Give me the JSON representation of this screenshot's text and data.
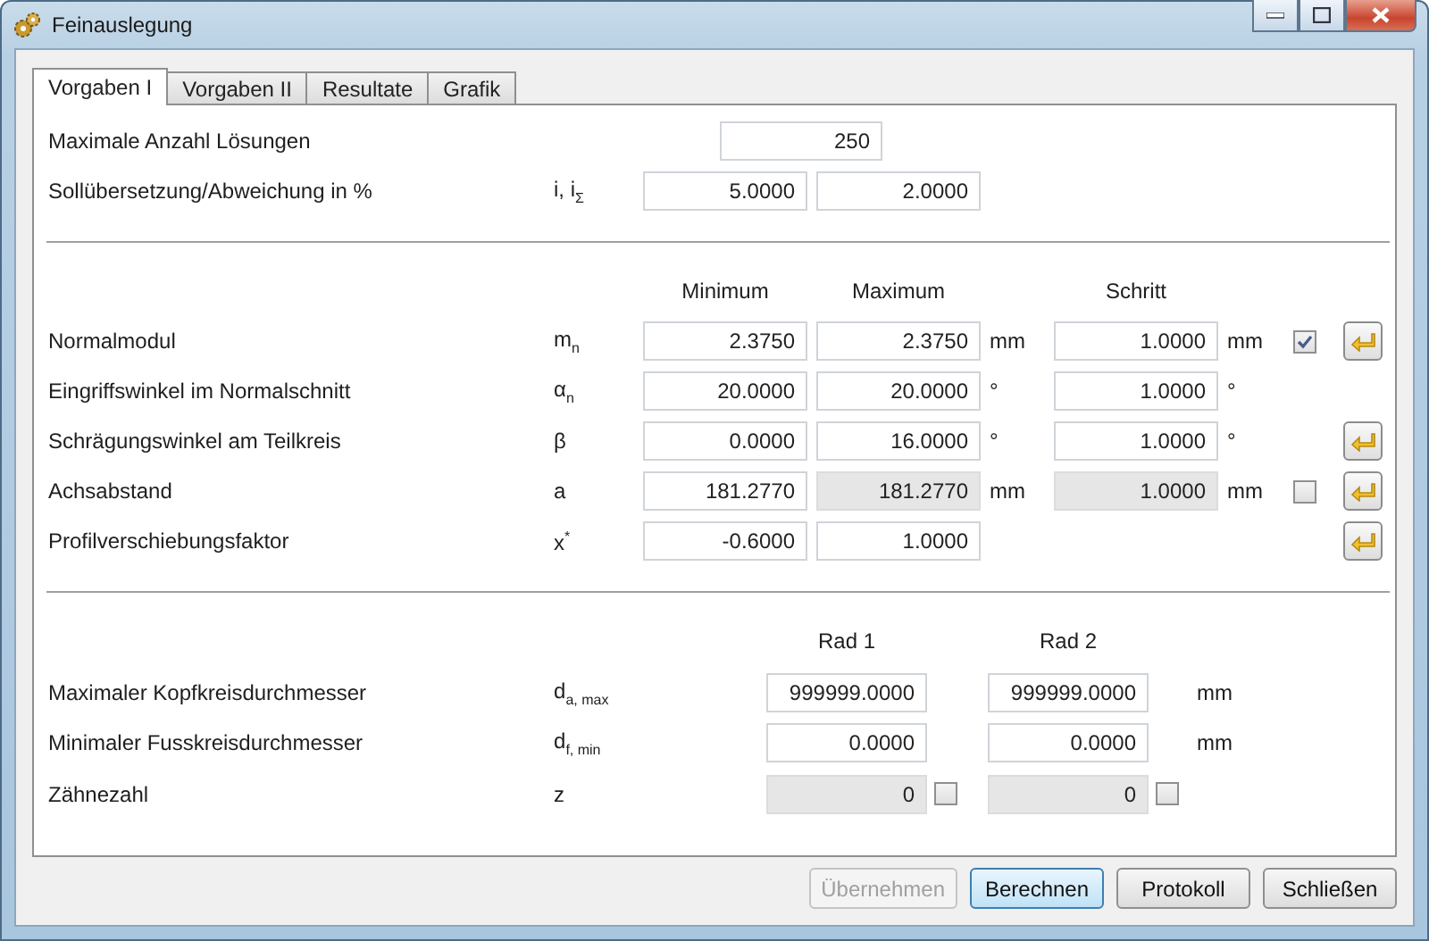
{
  "window": {
    "title": "Feinauslegung"
  },
  "tabs": [
    {
      "label": "Vorgaben I",
      "selected": true
    },
    {
      "label": "Vorgaben II",
      "selected": false
    },
    {
      "label": "Resultate",
      "selected": false
    },
    {
      "label": "Grafik",
      "selected": false
    }
  ],
  "max_solutions": {
    "label": "Maximale Anzahl Lösungen",
    "value": "250"
  },
  "target_ratio": {
    "label": "Sollübersetzung/Abweichung in %",
    "symbol": "i, i$_{Σ}$",
    "fields": [
      {
        "value": "5.0000",
        "disabled": false
      },
      {
        "value": "2.0000",
        "disabled": false
      }
    ]
  },
  "range_table": {
    "columns": [
      "Minimum",
      "Maximum",
      "Schritt"
    ],
    "rows": [
      {
        "label": "Normalmodul",
        "symbol": "m$_{n}$",
        "min": {
          "value": "2.3750",
          "disabled": false
        },
        "max": {
          "value": "2.3750",
          "disabled": false
        },
        "unit": "mm",
        "step": {
          "value": "1.0000",
          "disabled": false
        },
        "step_unit": "mm",
        "checkbox": {
          "checked": true
        },
        "apply_button": true
      },
      {
        "label": "Eingriffswinkel im Normalschnitt",
        "symbol": "α$_{n}$",
        "min": {
          "value": "20.0000",
          "disabled": false
        },
        "max": {
          "value": "20.0000",
          "disabled": false
        },
        "unit": "°",
        "step": {
          "value": "1.0000",
          "disabled": false
        },
        "step_unit": "°",
        "apply_button": false
      },
      {
        "label": "Schrägungswinkel am Teilkreis",
        "symbol": "β",
        "min": {
          "value": "0.0000",
          "disabled": false
        },
        "max": {
          "value": "16.0000",
          "disabled": false
        },
        "unit": "°",
        "step": {
          "value": "1.0000",
          "disabled": false
        },
        "step_unit": "°",
        "apply_button": true
      },
      {
        "label": "Achsabstand",
        "symbol": "a",
        "min": {
          "value": "181.2770",
          "disabled": false
        },
        "max": {
          "value": "181.2770",
          "disabled": true
        },
        "unit": "mm",
        "step": {
          "value": "1.0000",
          "disabled": true
        },
        "step_unit": "mm",
        "checkbox": {
          "checked": false
        },
        "apply_button": true
      },
      {
        "label": "Profilverschiebungsfaktor",
        "symbol": "x$^{*}$",
        "min": {
          "value": "-0.6000",
          "disabled": false
        },
        "max": {
          "value": "1.0000",
          "disabled": false
        },
        "apply_button": true
      }
    ]
  },
  "wheel_table": {
    "columns": [
      "Rad 1",
      "Rad 2"
    ],
    "rows": [
      {
        "label": "Maximaler Kopfkreisdurchmesser",
        "symbol": "d$_{a, max}$",
        "fields": [
          {
            "value": "999999.0000",
            "disabled": false
          },
          {
            "value": "999999.0000",
            "disabled": false
          }
        ],
        "unit": "mm"
      },
      {
        "label": "Minimaler Fusskreisdurchmesser",
        "symbol": "d$_{f, min}$",
        "fields": [
          {
            "value": "0.0000",
            "disabled": false
          },
          {
            "value": "0.0000",
            "disabled": false
          }
        ],
        "unit": "mm"
      },
      {
        "label": "Zähnezahl",
        "symbol": "z",
        "fields": [
          {
            "value": "0",
            "disabled": true,
            "checkbox": {
              "checked": false
            }
          },
          {
            "value": "0",
            "disabled": true,
            "checkbox": {
              "checked": false
            }
          }
        ]
      }
    ]
  },
  "buttons": [
    {
      "label": "Übernehmen",
      "disabled": true,
      "default": false
    },
    {
      "label": "Berechnen",
      "disabled": false,
      "default": true
    },
    {
      "label": "Protokoll",
      "disabled": false,
      "default": false
    },
    {
      "label": "Schließen",
      "disabled": false,
      "default": false
    }
  ]
}
